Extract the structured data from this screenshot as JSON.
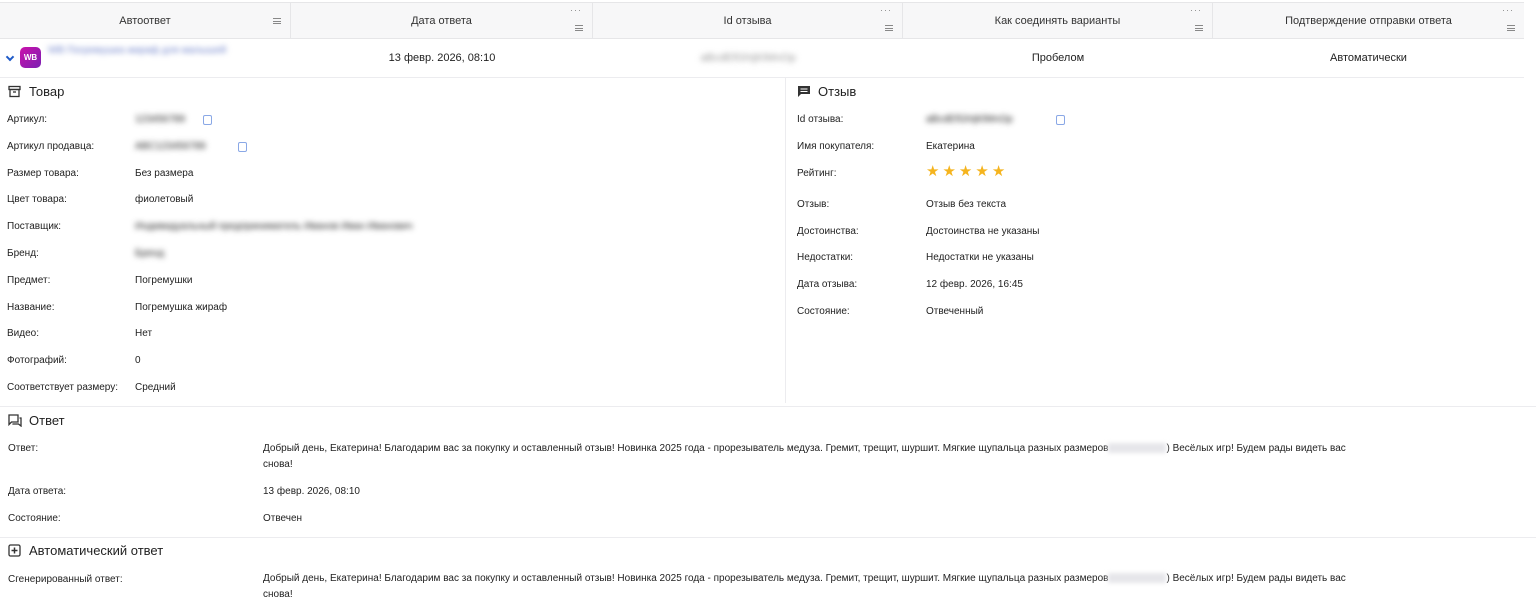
{
  "table": {
    "columns": [
      {
        "label": "Автоответ",
        "has_dots": false
      },
      {
        "label": "Дата ответа",
        "has_dots": true
      },
      {
        "label": "Id отзыва",
        "has_dots": true
      },
      {
        "label": "Как соединять варианты",
        "has_dots": true
      },
      {
        "label": "Подтверждение отправки ответа",
        "has_dots": true
      }
    ],
    "row": {
      "marketplace_badge": "WB",
      "autoreply_name": "WB Погремушка жираф для малышей",
      "date": "13 февр. 2026, 08:10",
      "review_id": "aBcdEfGhIjKlMnOp",
      "join_mode": "Пробелом",
      "confirm": "Автоматически"
    }
  },
  "product": {
    "title": "Товар",
    "fields": [
      {
        "label": "Артикул:",
        "value": "123456789"
      },
      {
        "label": "Артикул продавца:",
        "value": "ABC123456789"
      },
      {
        "label": "Размер товара:",
        "value": "Без размера"
      },
      {
        "label": "Цвет товара:",
        "value": "фиолетовый"
      },
      {
        "label": "Поставщик:",
        "value": "Индивидуальный предприниматель Иванов Иван Иванович"
      },
      {
        "label": "Бренд:",
        "value": "Бренд"
      },
      {
        "label": "Предмет:",
        "value": "Погремушки"
      },
      {
        "label": "Название:",
        "value": "Погремушка жираф"
      },
      {
        "label": "Видео:",
        "value": "Нет"
      },
      {
        "label": "Фотографий:",
        "value": "0"
      },
      {
        "label": "Соответствует размеру:",
        "value": "Средний"
      }
    ]
  },
  "review": {
    "title": "Отзыв",
    "fields": [
      {
        "label": "Id отзыва:",
        "value": "aBcdEfGhIjKlMnOp"
      },
      {
        "label": "Имя покупателя:",
        "value": "Екатерина"
      },
      {
        "label": "Рейтинг:",
        "value": ""
      },
      {
        "label": "Отзыв:",
        "value": "Отзыв без текста"
      },
      {
        "label": "Достоинства:",
        "value": "Достоинства не указаны"
      },
      {
        "label": "Недостатки:",
        "value": "Недостатки не указаны"
      },
      {
        "label": "Дата отзыва:",
        "value": "12 февр. 2026, 16:45"
      },
      {
        "label": "Состояние:",
        "value": "Отвеченный"
      }
    ],
    "rating": 5,
    "rating_max": 5
  },
  "answer": {
    "title": "Ответ",
    "answer_label": "Ответ:",
    "answer_text_1": "Добрый день, Екатерина! Благодарим вас за покупку и оставленный отзыв! Новинка 2025 года - прорезыватель медуза. Гремит, трещит, шуршит. Мягкие щупальца разных размеров",
    "answer_text_2": ") Весёлых игр! Будем рады видеть вас",
    "answer_text_3": "снова!",
    "date_label": "Дата ответа:",
    "date_value": "13 февр. 2026, 08:10",
    "state_label": "Состояние:",
    "state_value": "Отвечен"
  },
  "auto": {
    "title": "Автоматический ответ",
    "gen_label": "Сгенерированный ответ:",
    "gen_text_1": "Добрый день, Екатерина! Благодарим вас за покупку и оставленный отзыв! Новинка 2025 года - прорезыватель медуза. Гремит, трещит, шуршит. Мягкие щупальца разных размеров",
    "gen_text_2": ") Весёлых игр! Будем рады видеть вас",
    "gen_text_3": "снова!"
  },
  "colors": {
    "accent": "#1e5ac8",
    "star": "#f5b41e",
    "badge": "#a015af"
  }
}
